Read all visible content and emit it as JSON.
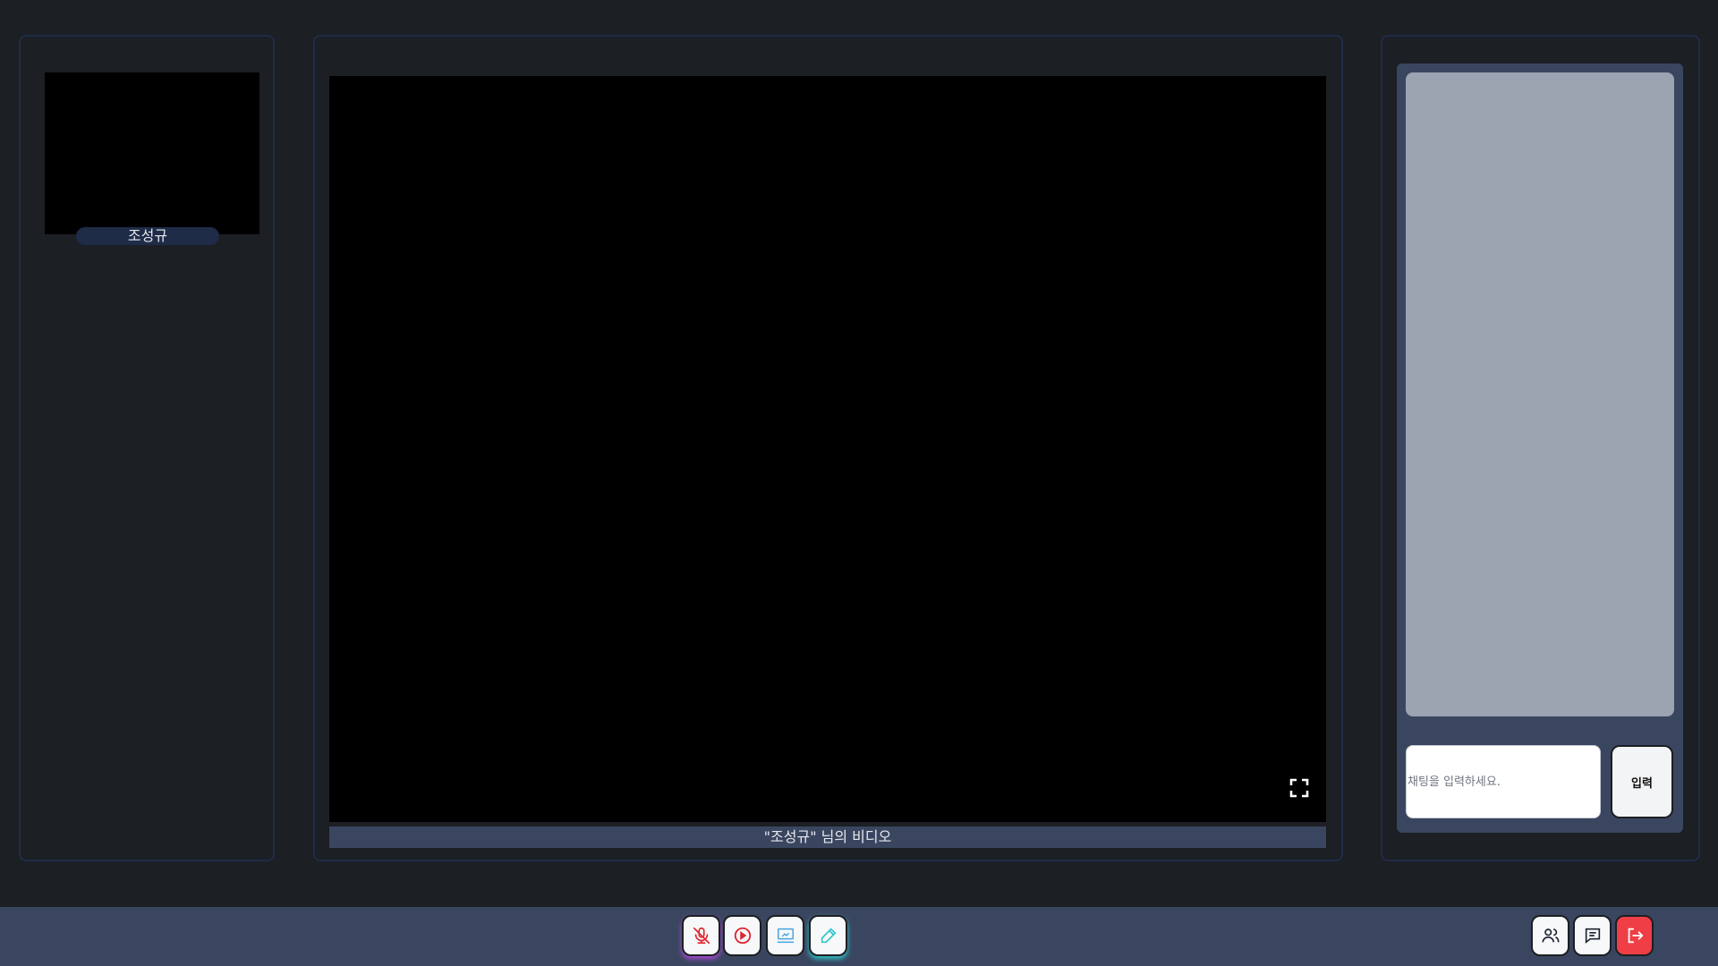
{
  "participants": [
    {
      "name": "조성규"
    }
  ],
  "main_video": {
    "caption": "\"조성규\" 님의 비디오",
    "fullscreen_icon": "fullscreen-icon"
  },
  "chat": {
    "input_placeholder": "채팅을 입력하세요.",
    "send_label": "입력"
  },
  "toolbar": {
    "center_buttons": [
      {
        "name": "mic-toggle",
        "icon": "mic-off-icon",
        "color": "#e0262e"
      },
      {
        "name": "video-toggle",
        "icon": "play-circle-icon",
        "color": "#e0262e"
      },
      {
        "name": "screen-share",
        "icon": "screen-share-icon",
        "color": "#4aa3df"
      },
      {
        "name": "whiteboard",
        "icon": "pencil-icon",
        "color": "#2fc7c9"
      }
    ],
    "right_buttons": [
      {
        "name": "participants",
        "icon": "users-icon"
      },
      {
        "name": "chat",
        "icon": "chat-icon"
      },
      {
        "name": "leave",
        "icon": "exit-icon",
        "color": "#ef3e45"
      }
    ]
  }
}
